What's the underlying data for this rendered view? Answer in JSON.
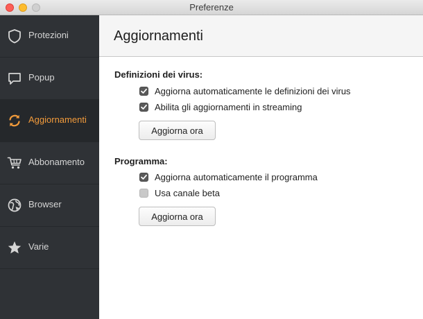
{
  "window": {
    "title": "Preferenze"
  },
  "sidebar": {
    "items": [
      {
        "label": "Protezioni",
        "icon": "shield-icon"
      },
      {
        "label": "Popup",
        "icon": "speech-bubble-icon"
      },
      {
        "label": "Aggiornamenti",
        "icon": "refresh-icon",
        "active": true
      },
      {
        "label": "Abbonamento",
        "icon": "shopping-cart-icon"
      },
      {
        "label": "Browser",
        "icon": "globe-icon"
      },
      {
        "label": "Varie",
        "icon": "star-icon"
      }
    ]
  },
  "main": {
    "title": "Aggiornamenti",
    "virus_section": {
      "title": "Definizioni dei virus:",
      "options": [
        {
          "label": "Aggiorna automaticamente le definizioni dei virus",
          "checked": true
        },
        {
          "label": "Abilita gli aggiornamenti in streaming",
          "checked": true
        }
      ],
      "button_label": "Aggiorna ora"
    },
    "program_section": {
      "title": "Programma:",
      "options": [
        {
          "label": "Aggiorna automaticamente il programma",
          "checked": true
        },
        {
          "label": "Usa canale beta",
          "checked": false
        }
      ],
      "button_label": "Aggiorna ora"
    }
  },
  "colors": {
    "sidebar_bg": "#2f3236",
    "sidebar_active_bg": "#25282b",
    "accent": "#f29b3b",
    "sidebar_text": "#d6d6d6"
  }
}
